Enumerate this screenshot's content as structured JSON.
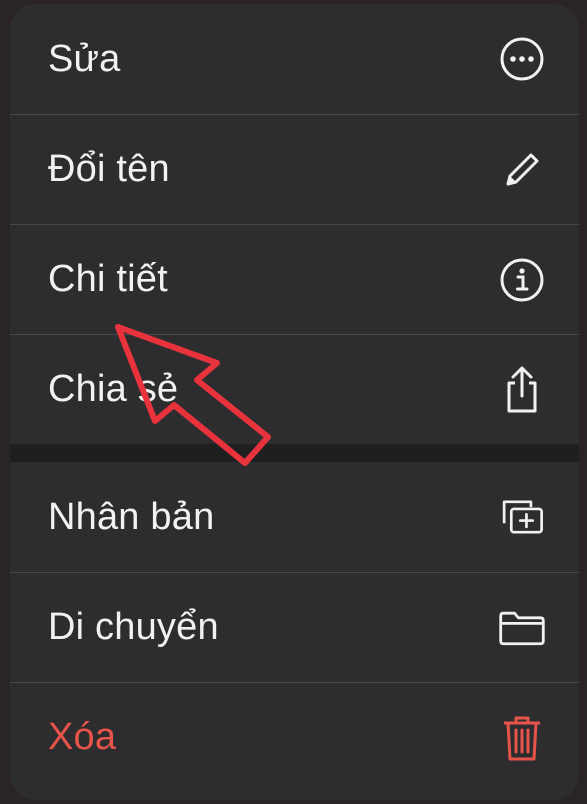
{
  "menu": {
    "groups": [
      {
        "items": [
          {
            "label": "Sửa",
            "icon": "ellipsis-circle-icon"
          },
          {
            "label": "Đổi tên",
            "icon": "pencil-icon"
          },
          {
            "label": "Chi tiết",
            "icon": "info-circle-icon"
          },
          {
            "label": "Chia sẻ",
            "icon": "share-icon"
          }
        ]
      },
      {
        "items": [
          {
            "label": "Nhân bản",
            "icon": "duplicate-icon"
          },
          {
            "label": "Di chuyển",
            "icon": "folder-icon"
          },
          {
            "label": "Xóa",
            "icon": "trash-icon",
            "destructive": true
          }
        ]
      }
    ]
  },
  "colors": {
    "menu_background": "#2d2c2e",
    "text": "#f2f2f2",
    "destructive": "#e6544a",
    "annotation_arrow": "#e8323c"
  }
}
